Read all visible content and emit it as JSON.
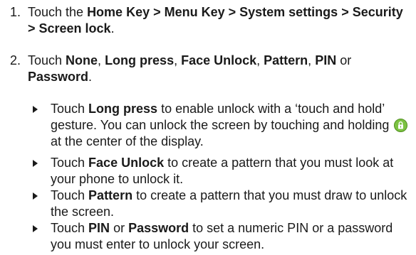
{
  "steps": [
    {
      "num": "1.",
      "parts": [
        {
          "text": "Touch the ",
          "bold": false
        },
        {
          "text": "Home Key > Menu Key > System settings > Security > Screen lock",
          "bold": true
        },
        {
          "text": ".",
          "bold": false
        }
      ]
    },
    {
      "num": "2.",
      "parts": [
        {
          "text": "Touch ",
          "bold": false
        },
        {
          "text": "None",
          "bold": true
        },
        {
          "text": ", ",
          "bold": false
        },
        {
          "text": "Long press",
          "bold": true
        },
        {
          "text": ", ",
          "bold": false
        },
        {
          "text": "Face Unlock",
          "bold": true
        },
        {
          "text": ", ",
          "bold": false
        },
        {
          "text": "Pattern",
          "bold": true
        },
        {
          "text": ", ",
          "bold": false
        },
        {
          "text": "PIN",
          "bold": true
        },
        {
          "text": " or ",
          "bold": false
        },
        {
          "text": "Password",
          "bold": true
        },
        {
          "text": ".",
          "bold": false
        }
      ]
    }
  ],
  "bullets": [
    {
      "parts": [
        {
          "text": "Touch ",
          "bold": false
        },
        {
          "text": "Long press",
          "bold": true
        },
        {
          "text": " to enable unlock with a ‘touch and hold’ gesture. You can unlock the screen by touching and holding",
          "bold": false
        },
        {
          "icon": "lock-icon"
        },
        {
          "text": "at the center of the display.",
          "bold": false
        }
      ]
    },
    {
      "parts": [
        {
          "text": "Touch ",
          "bold": false
        },
        {
          "text": "Face Unlock",
          "bold": true
        },
        {
          "text": " to create a pattern that you must look at your phone to unlock it.",
          "bold": false
        }
      ]
    },
    {
      "parts": [
        {
          "text": "Touch ",
          "bold": false
        },
        {
          "text": "Pattern",
          "bold": true
        },
        {
          "text": " to create a pattern that you must draw to unlock the screen.",
          "bold": false
        }
      ]
    },
    {
      "parts": [
        {
          "text": "Touch ",
          "bold": false
        },
        {
          "text": "PIN",
          "bold": true
        },
        {
          "text": " or ",
          "bold": false
        },
        {
          "text": "Password",
          "bold": true
        },
        {
          "text": " to set a numeric PIN or a password you must enter to unlock your screen.",
          "bold": false
        }
      ]
    }
  ],
  "colors": {
    "text": "#1a1a1a",
    "lock_icon_green": "#7cc242",
    "lock_icon_dark": "#4f8f1f"
  }
}
